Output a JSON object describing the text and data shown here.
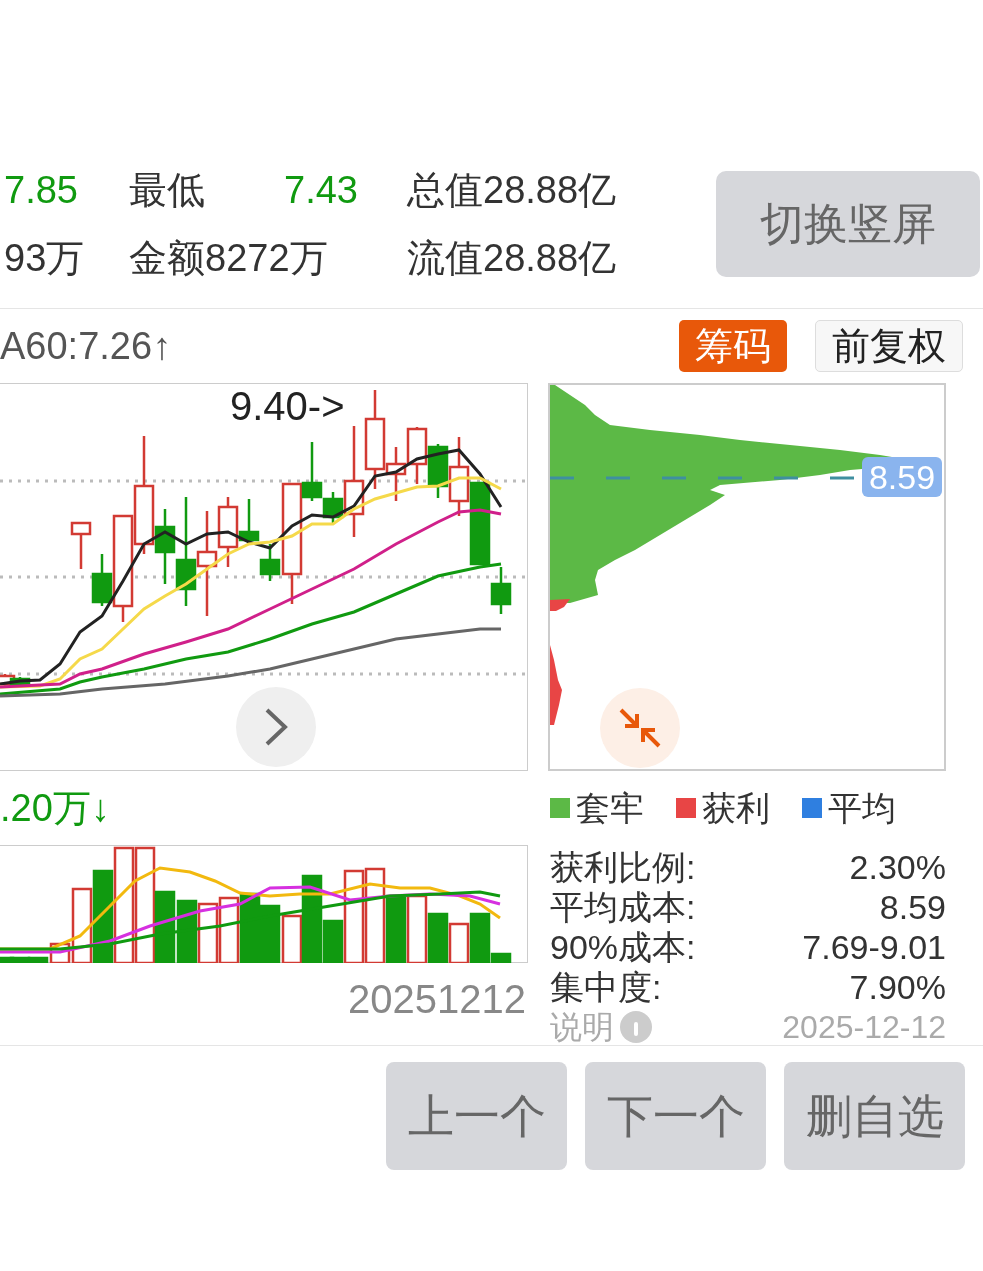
{
  "quote_rows": [
    [
      {
        "text": "7.85",
        "kind": "fall"
      },
      {
        "text": "最低",
        "kind": "plain"
      },
      {
        "text": "7.43",
        "kind": "fall"
      },
      {
        "text": "总值28.88亿",
        "kind": "plain"
      }
    ],
    [
      {
        "text": "93万",
        "kind": "plain"
      },
      {
        "text": "金额8272万",
        "kind": "plain"
      },
      {
        "text": "",
        "kind": "skip"
      },
      {
        "text": "流值28.88亿",
        "kind": "plain"
      }
    ]
  ],
  "switch_button": "切换竖屏",
  "ma_label": "A60:7.26↑",
  "tags": [
    {
      "label": "筹码",
      "selected": true
    },
    {
      "label": "前复权",
      "selected": false
    }
  ],
  "kline": {
    "high_label": "9.40->"
  },
  "chip": {
    "avg_label": "8.59"
  },
  "volume_label": ".20万↓",
  "date": "20251212",
  "legend": [
    {
      "label": "套牢",
      "color": "#5cb946"
    },
    {
      "label": "获利",
      "color": "#e84545"
    },
    {
      "label": "平均",
      "color": "#2f7fe0"
    }
  ],
  "stats": [
    {
      "label": "获利比例:",
      "value": "2.30%"
    },
    {
      "label": "平均成本:",
      "value": "8.59"
    },
    {
      "label": "90%成本:",
      "value": "7.69-9.01"
    },
    {
      "label": "集中度:",
      "value": "7.90%"
    }
  ],
  "note": {
    "label": "说明",
    "date": "2025-12-12"
  },
  "buttons": [
    "上一个",
    "下一个",
    "删自选"
  ]
}
